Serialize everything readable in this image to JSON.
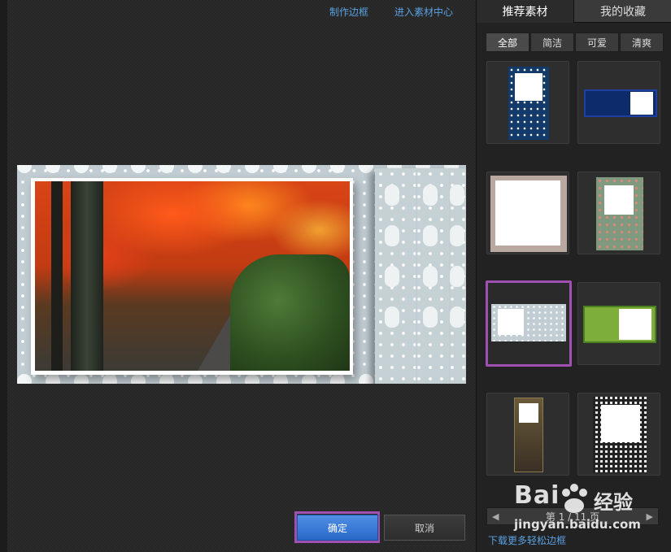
{
  "top_links": {
    "make_border": "制作边框",
    "material_center": "进入素材中心"
  },
  "buttons": {
    "ok": "确定",
    "cancel": "取消"
  },
  "tabs": {
    "recommended": "推荐素材",
    "favorites": "我的收藏"
  },
  "filters": [
    "全部",
    "简洁",
    "可爱",
    "清爽"
  ],
  "pager": {
    "prefix": "第",
    "page": "1",
    "sep": "/",
    "total": "11",
    "suffix": "页"
  },
  "download_link": "下载更多轻松边框",
  "watermark": {
    "logo": "Bai",
    "name": "经验",
    "url": "jingyan.baidu.com"
  },
  "colors": {
    "selection": "#a050b0",
    "link": "#5aa0e0",
    "ok_button": "#2a68c8"
  }
}
